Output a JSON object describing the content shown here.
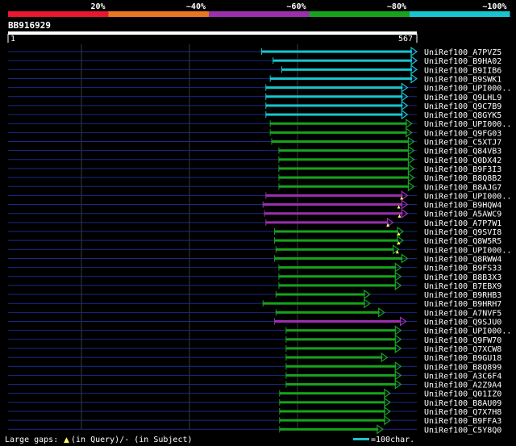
{
  "query": {
    "id": "BB916929",
    "start": "1",
    "end": "567",
    "length": 567
  },
  "identity_legend": [
    {
      "label": "20%",
      "color": "#e8182e"
    },
    {
      "label": "~40%",
      "color": "#e87722"
    },
    {
      "label": "~60%",
      "color": "#9b2fae"
    },
    {
      "label": "~80%",
      "color": "#17a31d"
    },
    {
      "label": "~100%",
      "color": "#18c4cf"
    }
  ],
  "colors": {
    "background": "#000000",
    "subject_line": "#1a2a8a",
    "gap_marker": "#ffff66"
  },
  "hits": [
    {
      "name": "UniRef100_A7PVZ5",
      "start": 352,
      "end": 567,
      "band": 4,
      "arrow": true
    },
    {
      "name": "UniRef100_B9HA02",
      "start": 368,
      "end": 567,
      "band": 4,
      "arrow": true
    },
    {
      "name": "UniRef100_B9IIB6",
      "start": 380,
      "end": 567,
      "band": 4,
      "arrow": true
    },
    {
      "name": "UniRef100_B9SWK1",
      "start": 364,
      "end": 567,
      "band": 4,
      "arrow": true
    },
    {
      "name": "UniRef100_UPI000..",
      "start": 358,
      "end": 554,
      "band": 4,
      "arrow": true
    },
    {
      "name": "UniRef100_Q9LHL9",
      "start": 358,
      "end": 554,
      "band": 4,
      "arrow": true
    },
    {
      "name": "UniRef100_Q9C7B9",
      "start": 358,
      "end": 554,
      "band": 4,
      "arrow": true
    },
    {
      "name": "UniRef100_Q8GYK5",
      "start": 358,
      "end": 554,
      "band": 4,
      "arrow": true
    },
    {
      "name": "UniRef100_UPI000..",
      "start": 364,
      "end": 560,
      "band": 3,
      "arrow": true
    },
    {
      "name": "UniRef100_Q9FG03",
      "start": 364,
      "end": 560,
      "band": 3,
      "arrow": true
    },
    {
      "name": "UniRef100_C5XTJ7",
      "start": 366,
      "end": 563,
      "band": 3,
      "arrow": true
    },
    {
      "name": "UniRef100_Q84VB3",
      "start": 376,
      "end": 563,
      "band": 3,
      "arrow": true
    },
    {
      "name": "UniRef100_Q0DX42",
      "start": 376,
      "end": 563,
      "band": 3,
      "arrow": true
    },
    {
      "name": "UniRef100_B9F3I3",
      "start": 376,
      "end": 563,
      "band": 3,
      "arrow": true
    },
    {
      "name": "UniRef100_B8Q8B2",
      "start": 376,
      "end": 563,
      "band": 3,
      "arrow": true
    },
    {
      "name": "UniRef100_B8AJG7",
      "start": 376,
      "end": 563,
      "band": 3,
      "arrow": true
    },
    {
      "name": "UniRef100_UPI000..",
      "start": 358,
      "end": 554,
      "band": 2,
      "arrow": true,
      "gap": 546
    },
    {
      "name": "UniRef100_B9HQW4",
      "start": 354,
      "end": 554,
      "band": 2,
      "arrow": true,
      "gap": 542
    },
    {
      "name": "UniRef100_A5AWC9",
      "start": 356,
      "end": 554,
      "band": 2,
      "arrow": true,
      "gap": 543
    },
    {
      "name": "UniRef100_A7P7W1",
      "start": 358,
      "end": 534,
      "band": 2,
      "arrow": true,
      "gap": 527
    },
    {
      "name": "UniRef100_Q9SVI8",
      "start": 370,
      "end": 548,
      "band": 3,
      "arrow": true,
      "gap": 542
    },
    {
      "name": "UniRef100_Q8W5R5",
      "start": 370,
      "end": 548,
      "band": 3,
      "arrow": true,
      "gap": 542
    },
    {
      "name": "UniRef100_UPI000..",
      "start": 372,
      "end": 542,
      "band": 3,
      "arrow": true,
      "gap": 540
    },
    {
      "name": "UniRef100_Q8RWW4",
      "start": 370,
      "end": 554,
      "band": 3,
      "arrow": true
    },
    {
      "name": "UniRef100_B9FS33",
      "start": 376,
      "end": 545,
      "band": 3,
      "arrow": true
    },
    {
      "name": "UniRef100_B8B3X3",
      "start": 376,
      "end": 545,
      "band": 3,
      "arrow": true
    },
    {
      "name": "UniRef100_B7EBX9",
      "start": 376,
      "end": 545,
      "band": 3,
      "arrow": true
    },
    {
      "name": "UniRef100_B9RHB3",
      "start": 372,
      "end": 502,
      "band": 3,
      "arrow": true
    },
    {
      "name": "UniRef100_B9HRH7",
      "start": 354,
      "end": 502,
      "band": 3,
      "arrow": true
    },
    {
      "name": "UniRef100_A7NVF5",
      "start": 372,
      "end": 522,
      "band": 3,
      "arrow": true
    },
    {
      "name": "UniRef100_Q9SJU0",
      "start": 370,
      "end": 552,
      "band": 2,
      "arrow": true
    },
    {
      "name": "UniRef100_UPI000..",
      "start": 386,
      "end": 545,
      "band": 3,
      "arrow": true
    },
    {
      "name": "UniRef100_Q9FW70",
      "start": 386,
      "end": 545,
      "band": 3,
      "arrow": true
    },
    {
      "name": "UniRef100_Q7XCW8",
      "start": 386,
      "end": 545,
      "band": 3,
      "arrow": true
    },
    {
      "name": "UniRef100_B9GU18",
      "start": 386,
      "end": 526,
      "band": 3,
      "arrow": true
    },
    {
      "name": "UniRef100_B8Q899",
      "start": 386,
      "end": 545,
      "band": 3,
      "arrow": true
    },
    {
      "name": "UniRef100_A3C6F4",
      "start": 386,
      "end": 545,
      "band": 3,
      "arrow": true
    },
    {
      "name": "UniRef100_A2Z9A4",
      "start": 386,
      "end": 545,
      "band": 3,
      "arrow": true
    },
    {
      "name": "UniRef100_Q01IZ0",
      "start": 377,
      "end": 530,
      "band": 3,
      "arrow": true
    },
    {
      "name": "UniRef100_B8AU09",
      "start": 377,
      "end": 530,
      "band": 3,
      "arrow": true
    },
    {
      "name": "UniRef100_Q7X7H8",
      "start": 377,
      "end": 530,
      "band": 3,
      "arrow": true
    },
    {
      "name": "UniRef100_B9FFA3",
      "start": 377,
      "end": 530,
      "band": 3,
      "arrow": true
    },
    {
      "name": "UniRef100_C5Y8Q0",
      "start": 377,
      "end": 520,
      "band": 3,
      "arrow": true
    }
  ],
  "footer": {
    "gaps_label": "Large gaps:",
    "gap_query_mark": "▲",
    "gap_query_label": "(in Query)/- (in Subject)",
    "scale_label": "=100char.",
    "scale_color": "#18c4cf"
  }
}
